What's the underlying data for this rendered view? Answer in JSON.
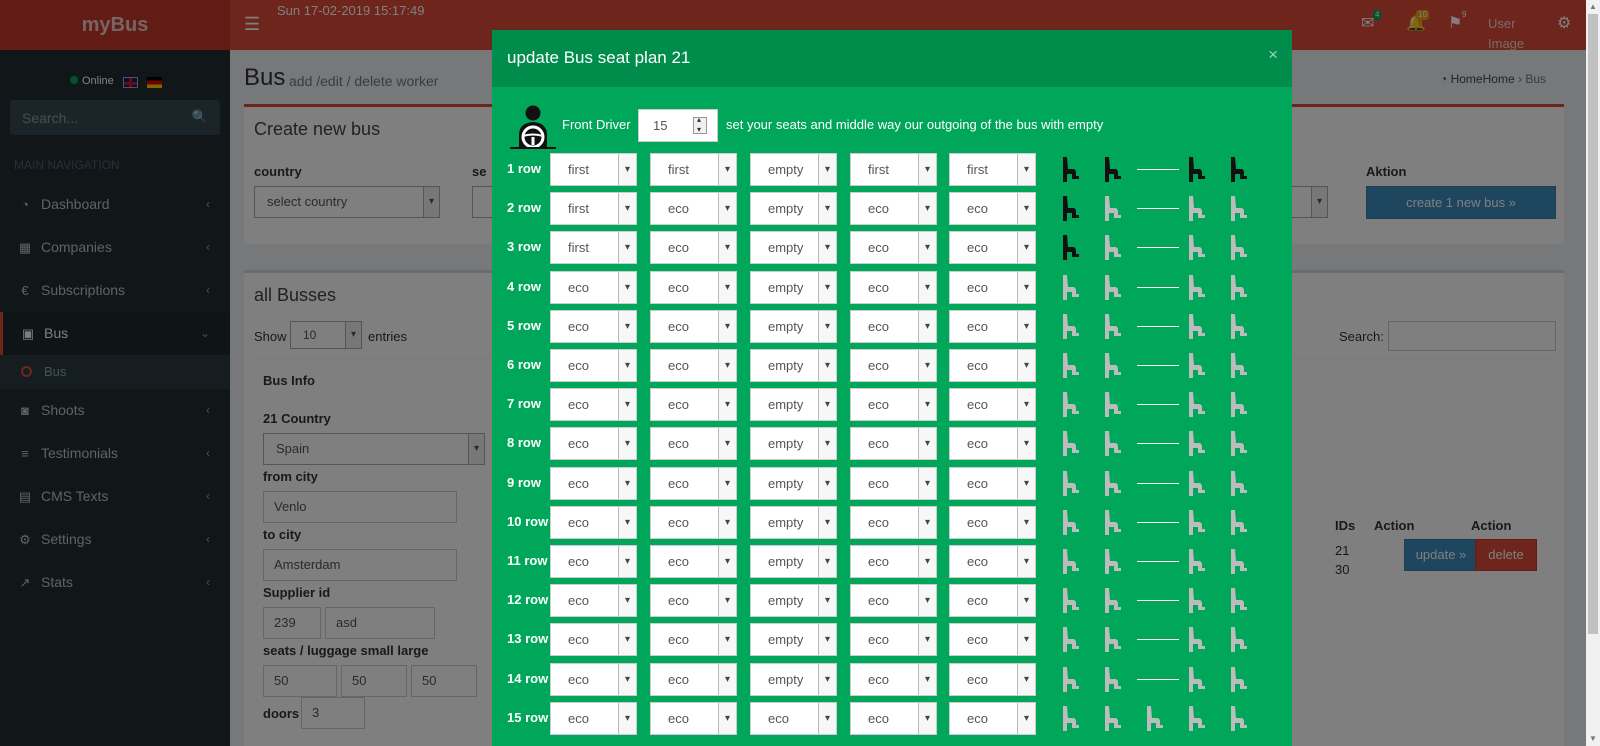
{
  "header": {
    "logo": "myBus",
    "datetime": "Sun 17-02-2019 15:17:49",
    "mail_badge": "4",
    "bell_badge": "10",
    "flag_badge": "9",
    "user_image": "User Image"
  },
  "sidebar": {
    "status": "Online",
    "search_placeholder": "Search...",
    "nav_header": "MAIN NAVIGATION",
    "items": [
      "Dashboard",
      "Companies",
      "Subscriptions",
      "Bus",
      "Shoots",
      "Testimonials",
      "CMS Texts",
      "Settings",
      "Stats"
    ],
    "sub_item": "Bus"
  },
  "content": {
    "title": "Bus",
    "subtitle": "add /edit / delete worker",
    "breadcrumb": [
      "HomeHome",
      "Bus"
    ],
    "create_box": {
      "title": "Create new bus",
      "country_label": "country",
      "country_select": "select country",
      "partial_label": "se",
      "aktion_label": "Aktion",
      "create_button": "create 1 new bus »"
    },
    "list_box": {
      "title": "all Busses",
      "show_label": "Show",
      "entries_value": "10",
      "entries_label": "entries",
      "search_label": "Search:",
      "bus_info_header": "Bus Info",
      "country_label": "21 Country",
      "country_value": "Spain",
      "from_city_label": "from city",
      "from_city_value": "Venlo",
      "to_city_label": "to city",
      "to_city_value": "Amsterdam",
      "supplier_label": "Supplier id",
      "supplier_id": "239",
      "supplier_name": "asd",
      "seats_label": "seats / luggage small large",
      "seats": "50",
      "luggage_small": "50",
      "luggage_large": "50",
      "doors_label": "doors",
      "doors_value": "3",
      "ids_header": "IDs",
      "action_header_1": "Action",
      "action_header_2": "Action",
      "ids": [
        "21",
        "30"
      ],
      "update_button": "update »",
      "delete_button": "delete"
    }
  },
  "modal": {
    "title": "update Bus seat plan 21",
    "driver_label": "Front Driver",
    "driver_value": "15",
    "hint": "set your seats and middle way our outgoing of the bus with empty",
    "rows": [
      {
        "label": "1 row",
        "seats": [
          "first",
          "first",
          "empty",
          "first",
          "first"
        ]
      },
      {
        "label": "2 row",
        "seats": [
          "first",
          "eco",
          "empty",
          "eco",
          "eco"
        ]
      },
      {
        "label": "3 row",
        "seats": [
          "first",
          "eco",
          "empty",
          "eco",
          "eco"
        ]
      },
      {
        "label": "4 row",
        "seats": [
          "eco",
          "eco",
          "empty",
          "eco",
          "eco"
        ]
      },
      {
        "label": "5 row",
        "seats": [
          "eco",
          "eco",
          "empty",
          "eco",
          "eco"
        ]
      },
      {
        "label": "6 row",
        "seats": [
          "eco",
          "eco",
          "empty",
          "eco",
          "eco"
        ]
      },
      {
        "label": "7 row",
        "seats": [
          "eco",
          "eco",
          "empty",
          "eco",
          "eco"
        ]
      },
      {
        "label": "8 row",
        "seats": [
          "eco",
          "eco",
          "empty",
          "eco",
          "eco"
        ]
      },
      {
        "label": "9 row",
        "seats": [
          "eco",
          "eco",
          "empty",
          "eco",
          "eco"
        ]
      },
      {
        "label": "10 row",
        "seats": [
          "eco",
          "eco",
          "empty",
          "eco",
          "eco"
        ]
      },
      {
        "label": "11 row",
        "seats": [
          "eco",
          "eco",
          "empty",
          "eco",
          "eco"
        ]
      },
      {
        "label": "12 row",
        "seats": [
          "eco",
          "eco",
          "empty",
          "eco",
          "eco"
        ]
      },
      {
        "label": "13 row",
        "seats": [
          "eco",
          "eco",
          "empty",
          "eco",
          "eco"
        ]
      },
      {
        "label": "14 row",
        "seats": [
          "eco",
          "eco",
          "empty",
          "eco",
          "eco"
        ]
      },
      {
        "label": "15 row",
        "seats": [
          "eco",
          "eco",
          "eco",
          "eco",
          "eco"
        ]
      }
    ]
  },
  "colors": {
    "header_red": "#dd4b39",
    "modal_green": "#00a65a",
    "first_seat": "#111111",
    "eco_seat": "#bcbcbc"
  }
}
